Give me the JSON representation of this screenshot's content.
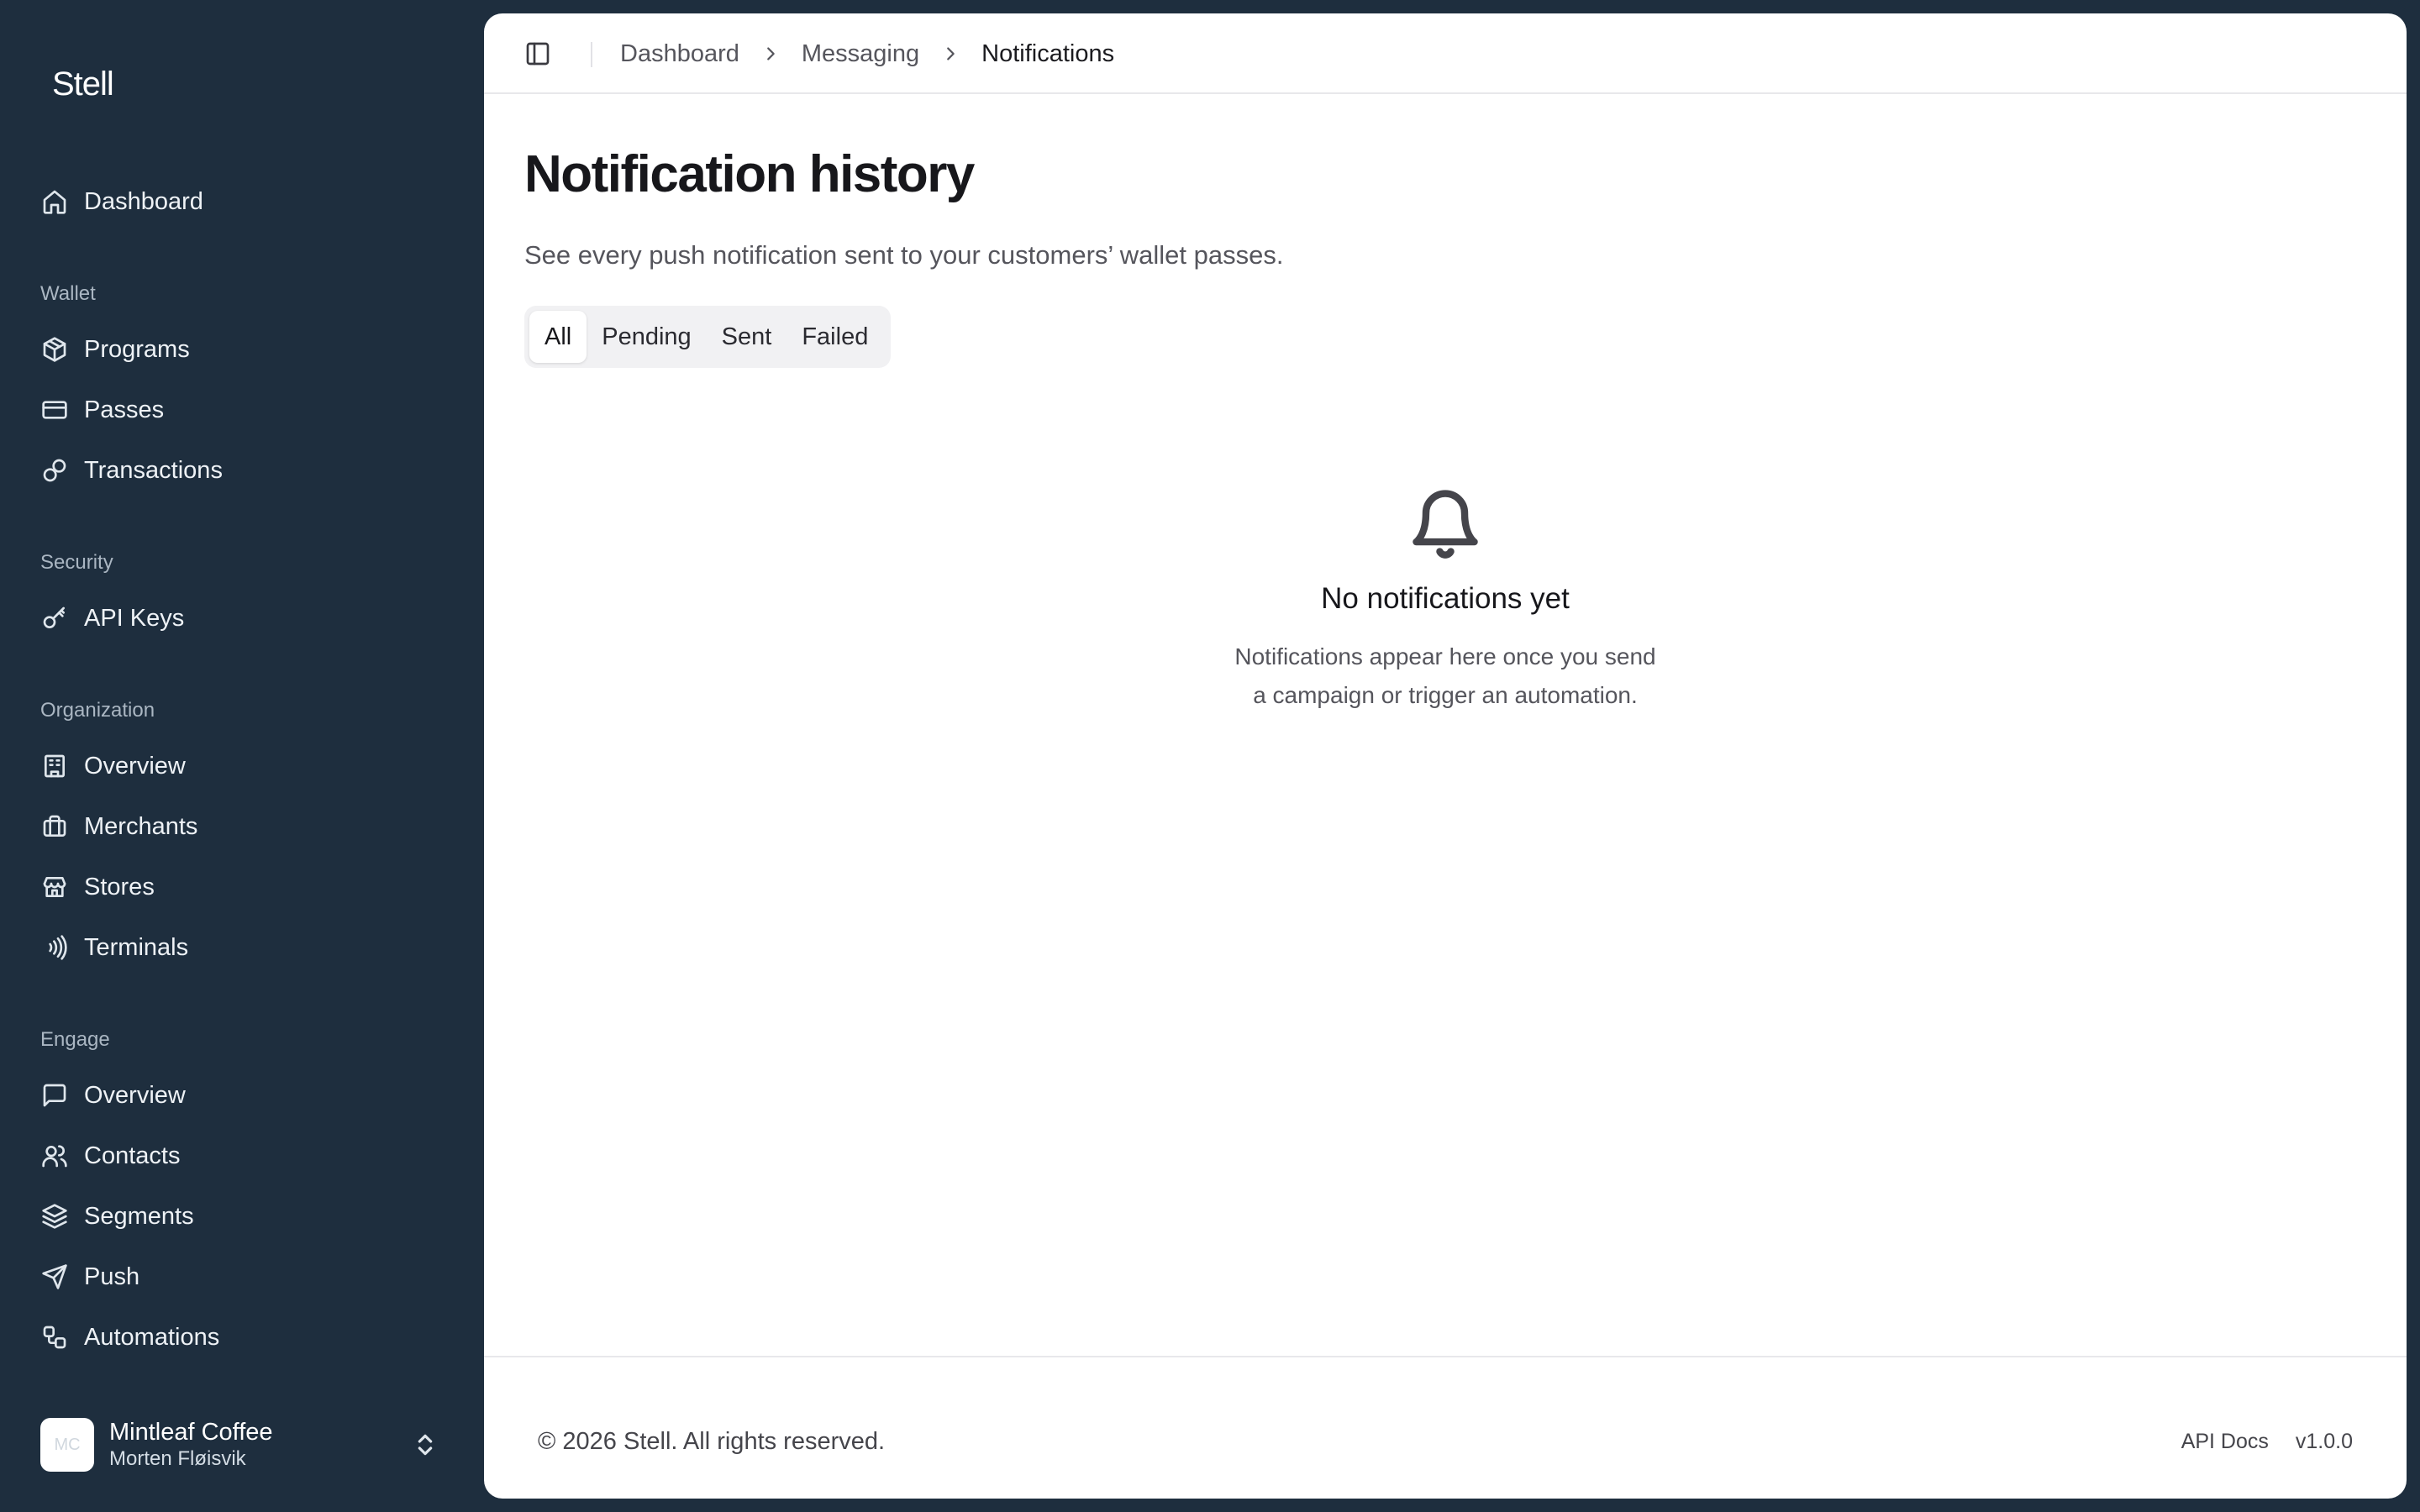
{
  "app": {
    "logo": "Stell"
  },
  "sidebar": {
    "items": [
      {
        "label": "Dashboard",
        "icon": "home-icon"
      },
      {
        "label": "Programs",
        "icon": "package-icon"
      },
      {
        "label": "Passes",
        "icon": "credit-card-icon"
      },
      {
        "label": "Transactions",
        "icon": "link-icon"
      },
      {
        "label": "API Keys",
        "icon": "key-icon"
      },
      {
        "label": "Overview",
        "icon": "building-icon"
      },
      {
        "label": "Merchants",
        "icon": "briefcase-icon"
      },
      {
        "label": "Stores",
        "icon": "store-icon"
      },
      {
        "label": "Terminals",
        "icon": "contactless-icon"
      },
      {
        "label": "Overview",
        "icon": "message-square-icon"
      },
      {
        "label": "Contacts",
        "icon": "users-icon"
      },
      {
        "label": "Segments",
        "icon": "layers-icon"
      },
      {
        "label": "Push",
        "icon": "send-icon"
      },
      {
        "label": "Automations",
        "icon": "workflow-icon"
      }
    ],
    "sections": {
      "wallet": "Wallet",
      "security": "Security",
      "organization": "Organization",
      "engage": "Engage"
    },
    "account": {
      "initials": "MC",
      "name": "Mintleaf Coffee",
      "user": "Morten Fløisvik"
    }
  },
  "breadcrumb": [
    "Dashboard",
    "Messaging",
    "Notifications"
  ],
  "page": {
    "title": "Notification history",
    "subtitle": "See every push notification sent to your customers’ wallet passes."
  },
  "tabs": [
    {
      "label": "All",
      "active": true
    },
    {
      "label": "Pending",
      "active": false
    },
    {
      "label": "Sent",
      "active": false
    },
    {
      "label": "Failed",
      "active": false
    }
  ],
  "empty_state": {
    "icon": "bell-icon",
    "title": "No notifications yet",
    "line1": "Notifications appear here once you send",
    "line2": "a campaign or trigger an automation."
  },
  "footer": {
    "copyright": "© 2026 Stell. All rights reserved.",
    "api_docs": "API Docs",
    "version": "v1.0.0"
  },
  "colors": {
    "sidebar_bg": "#1e2e3e",
    "main_bg": "#ffffff",
    "tab_bar_bg": "#f1f1f3"
  }
}
